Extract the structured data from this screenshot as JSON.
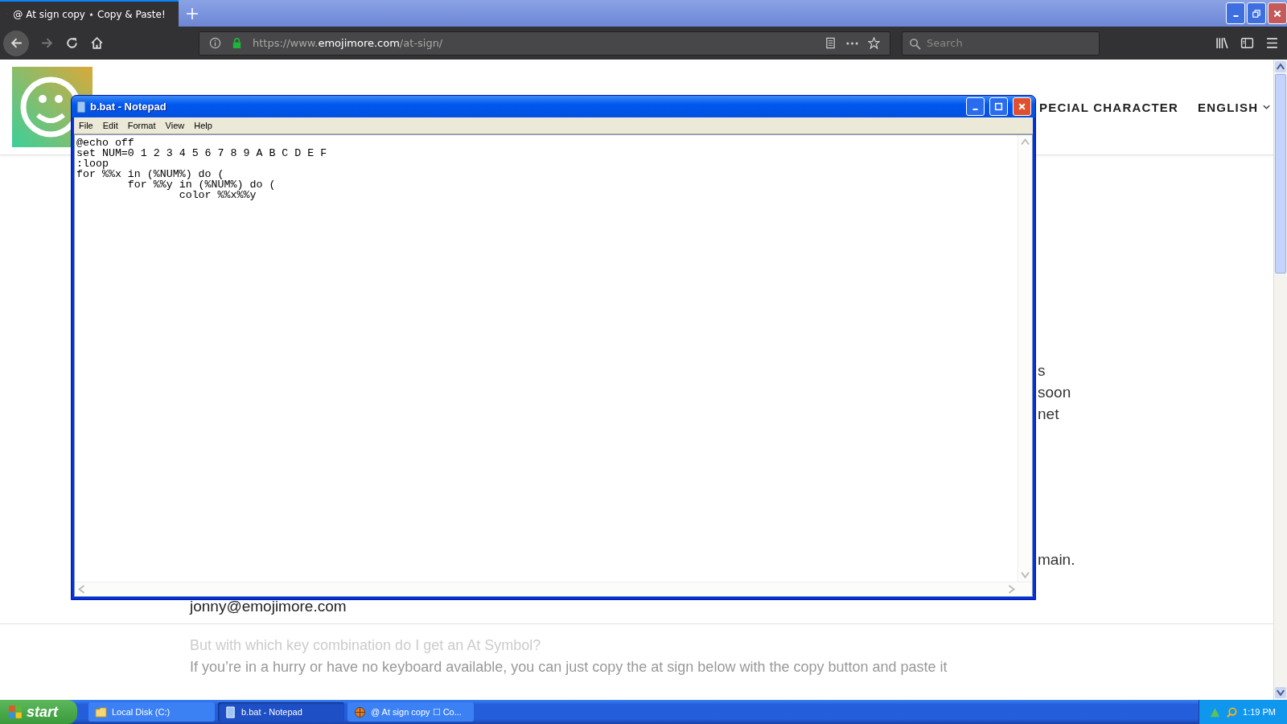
{
  "browser": {
    "tabs": [
      {
        "title": "@ At sign copy ⋆ Copy & Paste!",
        "selected": true
      }
    ],
    "url": {
      "prefix": "https://www.",
      "domain": "emojimore.com",
      "path": "/at-sign/"
    },
    "search": {
      "placeholder": "Search"
    }
  },
  "page": {
    "nav": [
      "PECIAL CHARACTER",
      "ENGLISH"
    ],
    "fragments": [
      "s",
      "soon",
      "net"
    ],
    "fragment_end": "main.",
    "email": "jonny@emojimore.com",
    "question": "But with which key combination do I get an At Symbol?",
    "paragraph": "If you’re in a hurry or have no keyboard available, you can just copy the at sign below with the copy button and paste it"
  },
  "notepad": {
    "title": "b.bat - Notepad",
    "menu": [
      "File",
      "Edit",
      "Format",
      "View",
      "Help"
    ],
    "lines": [
      "@echo off",
      "set NUM=0 1 2 3 4 5 6 7 8 9 A B C D E F",
      ":loop",
      "for %%x in (%NUM%) do (",
      "\tfor %%y in (%NUM%) do (",
      "\t\tcolor %%x%%y"
    ]
  },
  "taskbar": {
    "start": "start",
    "items": [
      {
        "label": "Local Disk (C:)",
        "kind": "folder",
        "selected": false
      },
      {
        "label": "b.bat - Notepad",
        "kind": "notepad",
        "selected": true
      },
      {
        "label": "@ At sign copy ☐ Co...",
        "kind": "browser",
        "selected": false
      }
    ],
    "clock": "1:19 PM"
  }
}
